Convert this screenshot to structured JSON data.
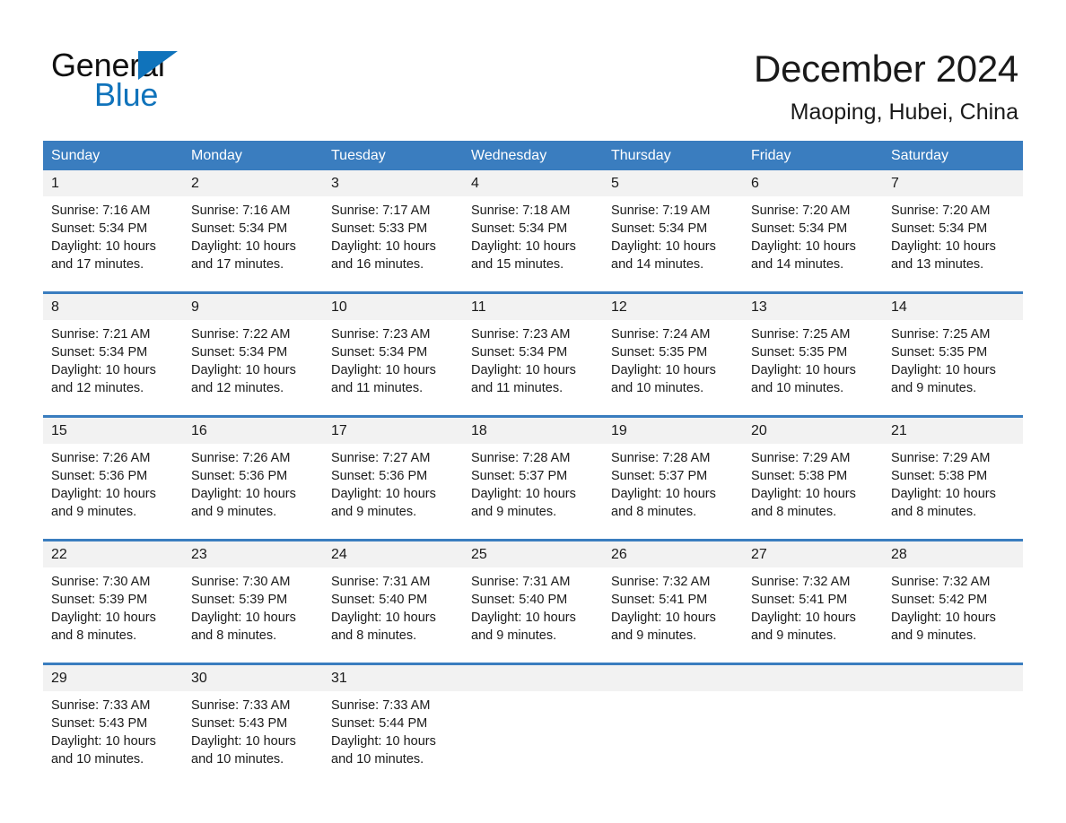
{
  "brand": {
    "name_part1": "General",
    "name_part2": "Blue",
    "accent_color": "#1073bb",
    "triangle_icon": "triangle-logo-mark"
  },
  "header": {
    "title": "December 2024",
    "subtitle": "Maoping, Hubei, China"
  },
  "theme": {
    "header_row_bg": "#3a7dbf",
    "date_band_bg": "#f2f2f2",
    "cell_bg": "#ffffff",
    "text_color": "#1a1a1a",
    "header_text_color": "#ffffff"
  },
  "weekdays": [
    "Sunday",
    "Monday",
    "Tuesday",
    "Wednesday",
    "Thursday",
    "Friday",
    "Saturday"
  ],
  "weeks": [
    {
      "days": [
        {
          "date": "1",
          "sunrise": "Sunrise: 7:16 AM",
          "sunset": "Sunset: 5:34 PM",
          "daylight": "Daylight: 10 hours and 17 minutes."
        },
        {
          "date": "2",
          "sunrise": "Sunrise: 7:16 AM",
          "sunset": "Sunset: 5:34 PM",
          "daylight": "Daylight: 10 hours and 17 minutes."
        },
        {
          "date": "3",
          "sunrise": "Sunrise: 7:17 AM",
          "sunset": "Sunset: 5:33 PM",
          "daylight": "Daylight: 10 hours and 16 minutes."
        },
        {
          "date": "4",
          "sunrise": "Sunrise: 7:18 AM",
          "sunset": "Sunset: 5:34 PM",
          "daylight": "Daylight: 10 hours and 15 minutes."
        },
        {
          "date": "5",
          "sunrise": "Sunrise: 7:19 AM",
          "sunset": "Sunset: 5:34 PM",
          "daylight": "Daylight: 10 hours and 14 minutes."
        },
        {
          "date": "6",
          "sunrise": "Sunrise: 7:20 AM",
          "sunset": "Sunset: 5:34 PM",
          "daylight": "Daylight: 10 hours and 14 minutes."
        },
        {
          "date": "7",
          "sunrise": "Sunrise: 7:20 AM",
          "sunset": "Sunset: 5:34 PM",
          "daylight": "Daylight: 10 hours and 13 minutes."
        }
      ]
    },
    {
      "days": [
        {
          "date": "8",
          "sunrise": "Sunrise: 7:21 AM",
          "sunset": "Sunset: 5:34 PM",
          "daylight": "Daylight: 10 hours and 12 minutes."
        },
        {
          "date": "9",
          "sunrise": "Sunrise: 7:22 AM",
          "sunset": "Sunset: 5:34 PM",
          "daylight": "Daylight: 10 hours and 12 minutes."
        },
        {
          "date": "10",
          "sunrise": "Sunrise: 7:23 AM",
          "sunset": "Sunset: 5:34 PM",
          "daylight": "Daylight: 10 hours and 11 minutes."
        },
        {
          "date": "11",
          "sunrise": "Sunrise: 7:23 AM",
          "sunset": "Sunset: 5:34 PM",
          "daylight": "Daylight: 10 hours and 11 minutes."
        },
        {
          "date": "12",
          "sunrise": "Sunrise: 7:24 AM",
          "sunset": "Sunset: 5:35 PM",
          "daylight": "Daylight: 10 hours and 10 minutes."
        },
        {
          "date": "13",
          "sunrise": "Sunrise: 7:25 AM",
          "sunset": "Sunset: 5:35 PM",
          "daylight": "Daylight: 10 hours and 10 minutes."
        },
        {
          "date": "14",
          "sunrise": "Sunrise: 7:25 AM",
          "sunset": "Sunset: 5:35 PM",
          "daylight": "Daylight: 10 hours and 9 minutes."
        }
      ]
    },
    {
      "days": [
        {
          "date": "15",
          "sunrise": "Sunrise: 7:26 AM",
          "sunset": "Sunset: 5:36 PM",
          "daylight": "Daylight: 10 hours and 9 minutes."
        },
        {
          "date": "16",
          "sunrise": "Sunrise: 7:26 AM",
          "sunset": "Sunset: 5:36 PM",
          "daylight": "Daylight: 10 hours and 9 minutes."
        },
        {
          "date": "17",
          "sunrise": "Sunrise: 7:27 AM",
          "sunset": "Sunset: 5:36 PM",
          "daylight": "Daylight: 10 hours and 9 minutes."
        },
        {
          "date": "18",
          "sunrise": "Sunrise: 7:28 AM",
          "sunset": "Sunset: 5:37 PM",
          "daylight": "Daylight: 10 hours and 9 minutes."
        },
        {
          "date": "19",
          "sunrise": "Sunrise: 7:28 AM",
          "sunset": "Sunset: 5:37 PM",
          "daylight": "Daylight: 10 hours and 8 minutes."
        },
        {
          "date": "20",
          "sunrise": "Sunrise: 7:29 AM",
          "sunset": "Sunset: 5:38 PM",
          "daylight": "Daylight: 10 hours and 8 minutes."
        },
        {
          "date": "21",
          "sunrise": "Sunrise: 7:29 AM",
          "sunset": "Sunset: 5:38 PM",
          "daylight": "Daylight: 10 hours and 8 minutes."
        }
      ]
    },
    {
      "days": [
        {
          "date": "22",
          "sunrise": "Sunrise: 7:30 AM",
          "sunset": "Sunset: 5:39 PM",
          "daylight": "Daylight: 10 hours and 8 minutes."
        },
        {
          "date": "23",
          "sunrise": "Sunrise: 7:30 AM",
          "sunset": "Sunset: 5:39 PM",
          "daylight": "Daylight: 10 hours and 8 minutes."
        },
        {
          "date": "24",
          "sunrise": "Sunrise: 7:31 AM",
          "sunset": "Sunset: 5:40 PM",
          "daylight": "Daylight: 10 hours and 8 minutes."
        },
        {
          "date": "25",
          "sunrise": "Sunrise: 7:31 AM",
          "sunset": "Sunset: 5:40 PM",
          "daylight": "Daylight: 10 hours and 9 minutes."
        },
        {
          "date": "26",
          "sunrise": "Sunrise: 7:32 AM",
          "sunset": "Sunset: 5:41 PM",
          "daylight": "Daylight: 10 hours and 9 minutes."
        },
        {
          "date": "27",
          "sunrise": "Sunrise: 7:32 AM",
          "sunset": "Sunset: 5:41 PM",
          "daylight": "Daylight: 10 hours and 9 minutes."
        },
        {
          "date": "28",
          "sunrise": "Sunrise: 7:32 AM",
          "sunset": "Sunset: 5:42 PM",
          "daylight": "Daylight: 10 hours and 9 minutes."
        }
      ]
    },
    {
      "days": [
        {
          "date": "29",
          "sunrise": "Sunrise: 7:33 AM",
          "sunset": "Sunset: 5:43 PM",
          "daylight": "Daylight: 10 hours and 10 minutes."
        },
        {
          "date": "30",
          "sunrise": "Sunrise: 7:33 AM",
          "sunset": "Sunset: 5:43 PM",
          "daylight": "Daylight: 10 hours and 10 minutes."
        },
        {
          "date": "31",
          "sunrise": "Sunrise: 7:33 AM",
          "sunset": "Sunset: 5:44 PM",
          "daylight": "Daylight: 10 hours and 10 minutes."
        },
        {
          "date": "",
          "sunrise": "",
          "sunset": "",
          "daylight": ""
        },
        {
          "date": "",
          "sunrise": "",
          "sunset": "",
          "daylight": ""
        },
        {
          "date": "",
          "sunrise": "",
          "sunset": "",
          "daylight": ""
        },
        {
          "date": "",
          "sunrise": "",
          "sunset": "",
          "daylight": ""
        }
      ]
    }
  ]
}
